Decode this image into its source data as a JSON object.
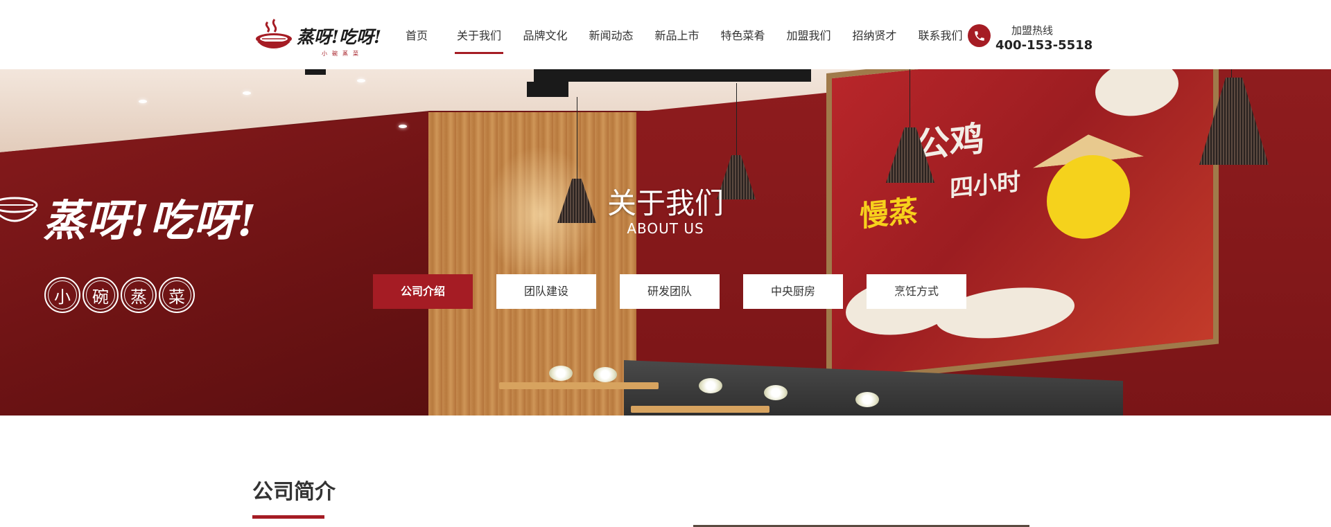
{
  "header": {
    "logo": {
      "text": "蒸呀!吃呀!",
      "subtext": "小碗蒸菜",
      "icon": "steamer-bowl-logo"
    },
    "nav": [
      {
        "label": "首页",
        "active": false
      },
      {
        "label": "关于我们",
        "active": true
      },
      {
        "label": "品牌文化",
        "active": false
      },
      {
        "label": "新闻动态",
        "active": false
      },
      {
        "label": "新品上市",
        "active": false
      },
      {
        "label": "特色菜肴",
        "active": false
      },
      {
        "label": "加盟我们",
        "active": false
      },
      {
        "label": "招纳贤才",
        "active": false
      },
      {
        "label": "联系我们",
        "active": false
      }
    ],
    "hotline": {
      "icon": "phone-icon",
      "label": "加盟热线",
      "number": "400-153-5518"
    }
  },
  "banner": {
    "title": "关于我们",
    "subtitle": "ABOUT US",
    "brand_text": "蒸呀!吃呀!",
    "brand_chars": [
      "小",
      "碗",
      "蒸",
      "菜"
    ],
    "mural_text": [
      "公鸡",
      "四小时",
      "慢蒸"
    ],
    "sub_tabs": [
      {
        "label": "公司介绍",
        "active": true
      },
      {
        "label": "团队建设",
        "active": false
      },
      {
        "label": "研发团队",
        "active": false
      },
      {
        "label": "中央厨房",
        "active": false
      },
      {
        "label": "烹饪方式",
        "active": false
      }
    ]
  },
  "section": {
    "title": "公司简介"
  },
  "colors": {
    "accent": "#a51c24",
    "banner_wall": "#7a1517",
    "text": "#333333"
  }
}
